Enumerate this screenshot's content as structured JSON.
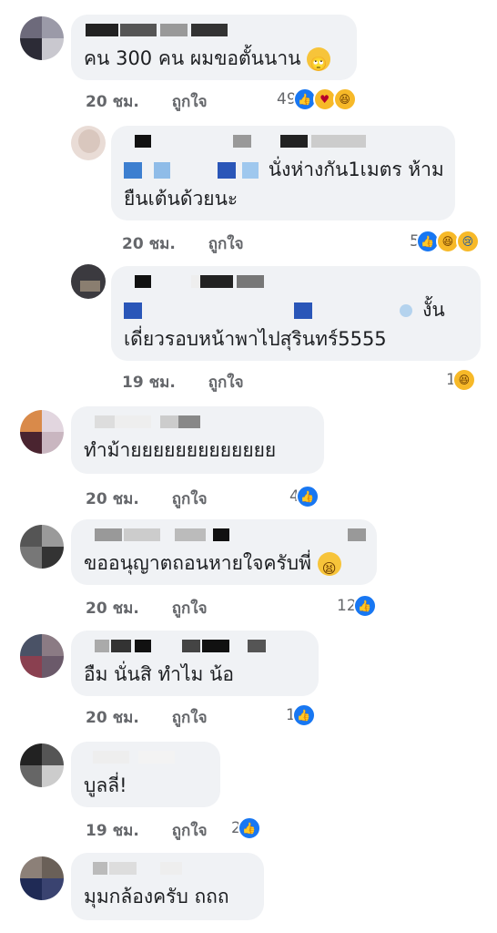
{
  "comments": [
    {
      "text": "คน 300 คน ผมขอตั้นนาน",
      "time": "20 ชม.",
      "like_label": "ถูกใจ",
      "reactions": "49",
      "emoji": "rolling-eyes"
    },
    {
      "text_line1": "นั่งห่างกัน1เมตร ห้าม",
      "text_line2": "ยืนเต้นด้วยนะ",
      "time": "20 ชม.",
      "like_label": "ถูกใจ",
      "reactions": "5"
    },
    {
      "text_line1": "งั้น",
      "text_line2": "เดี่ยวรอบหน้าพาไปสุรินทร์5555",
      "time": "19 ชม.",
      "like_label": "ถูกใจ",
      "reactions": "1"
    },
    {
      "text": "ทำม้ายยยยยยยยยยยยย",
      "time": "20 ชม.",
      "like_label": "ถูกใจ",
      "reactions": "4"
    },
    {
      "text": "ขออนุญาตถอนหายใจครับพี่",
      "time": "20 ชม.",
      "like_label": "ถูกใจ",
      "reactions": "12",
      "emoji": "tired-face"
    },
    {
      "text": "อืม นั่นสิ ทำไม น้อ",
      "time": "20 ชม.",
      "like_label": "ถูกใจ",
      "reactions": "1"
    },
    {
      "text": "บูลลี่!",
      "time": "19 ชม.",
      "like_label": "ถูกใจ",
      "reactions": "2"
    },
    {
      "text": "มุมกล้องครับ ถถถ"
    }
  ],
  "colors": {
    "like": "#1877f2",
    "bubble": "#f0f2f5",
    "meta": "#65676b"
  }
}
